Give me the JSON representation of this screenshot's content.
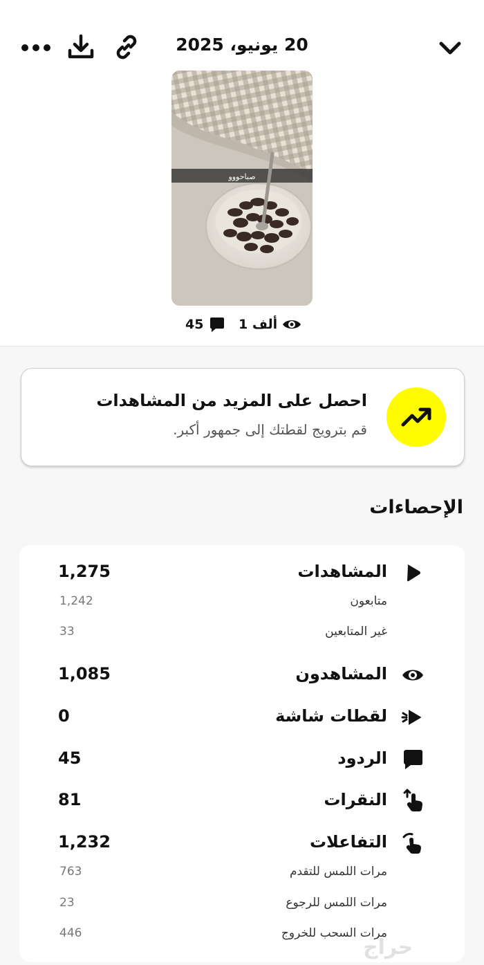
{
  "header": {
    "date": "20 يونيو، 2025",
    "icons": [
      "chevron-down-icon",
      "link-icon",
      "download-icon",
      "more-icon"
    ]
  },
  "snap": {
    "caption": "صباحووو",
    "views": "1 ألف",
    "replies": "45"
  },
  "promo": {
    "title": "احصل على المزيد من المشاهدات",
    "subtitle": "قم بترويج لقطتك إلى جمهور أكبر.",
    "accent": "#fffc00"
  },
  "stats": {
    "heading": "الإحصاءات",
    "views": {
      "label": "المشاهدات",
      "value": "1,275",
      "followers_label": "متابعون",
      "followers_value": "1,242",
      "nonfollowers_label": "غير المتابعين",
      "nonfollowers_value": "33"
    },
    "viewers": {
      "label": "المشاهدون",
      "value": "1,085"
    },
    "screenshots": {
      "label": "لقطات شاشة",
      "value": "0"
    },
    "replies": {
      "label": "الردود",
      "value": "45"
    },
    "taps": {
      "label": "النقرات",
      "value": "81"
    },
    "interactions": {
      "label": "التفاعلات",
      "value": "1,232",
      "forward_label": "مرات اللمس للتقدم",
      "forward_value": "763",
      "back_label": "مرات اللمس للرجوع",
      "back_value": "23",
      "exit_label": "مرات السحب للخروج",
      "exit_value": "446"
    }
  },
  "watermark": "حراج"
}
